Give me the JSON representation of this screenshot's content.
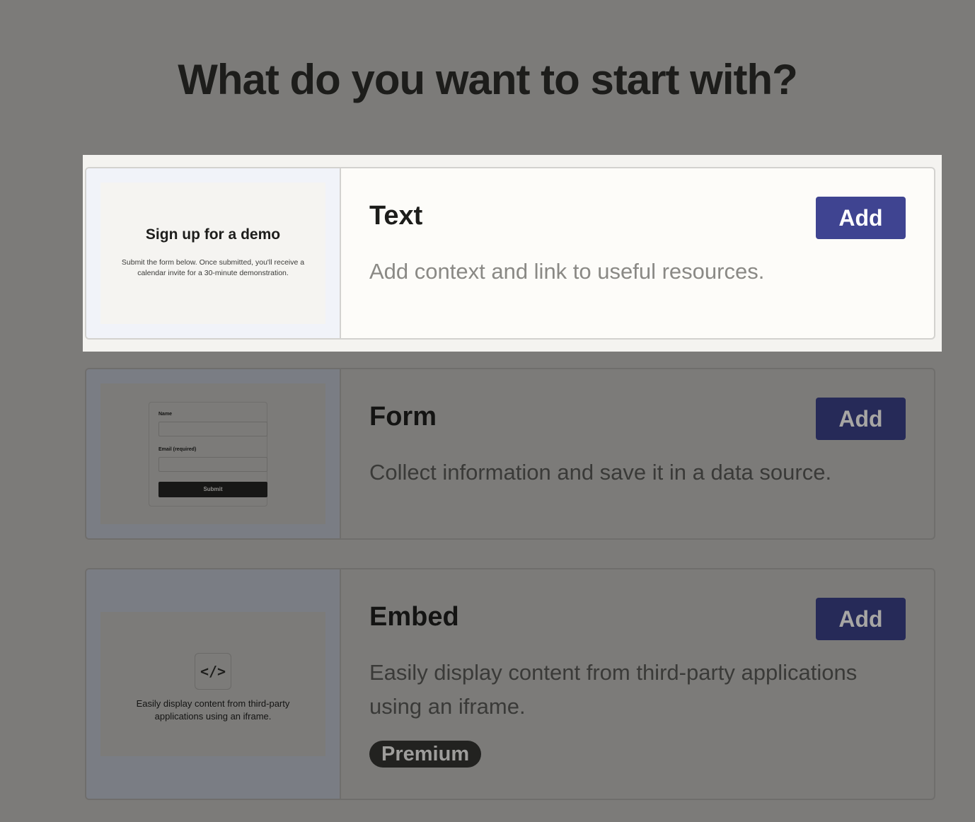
{
  "page": {
    "title": "What do you want to start with?"
  },
  "options": [
    {
      "title": "Text",
      "description": "Add context and link to useful resources.",
      "add_label": "Add",
      "preview": {
        "heading": "Sign up for a demo",
        "body": "Submit the form below. Once submitted, you'll receive a calendar invite for a 30-minute demonstration."
      }
    },
    {
      "title": "Form",
      "description": "Collect information and save it in a data source.",
      "add_label": "Add",
      "preview": {
        "field1_label": "Name",
        "field2_label": "Email (required)",
        "submit_label": "Submit"
      }
    },
    {
      "title": "Embed",
      "description": "Easily display content from third-party applications using an iframe.",
      "add_label": "Add",
      "badge": "Premium",
      "preview": {
        "icon": "</>",
        "caption": "Easily display content from third-party applications using an iframe."
      }
    }
  ],
  "colors": {
    "overlay": "#7c7b79",
    "accent": "#3f4491",
    "card_active_bg": "#fdfcf9"
  }
}
